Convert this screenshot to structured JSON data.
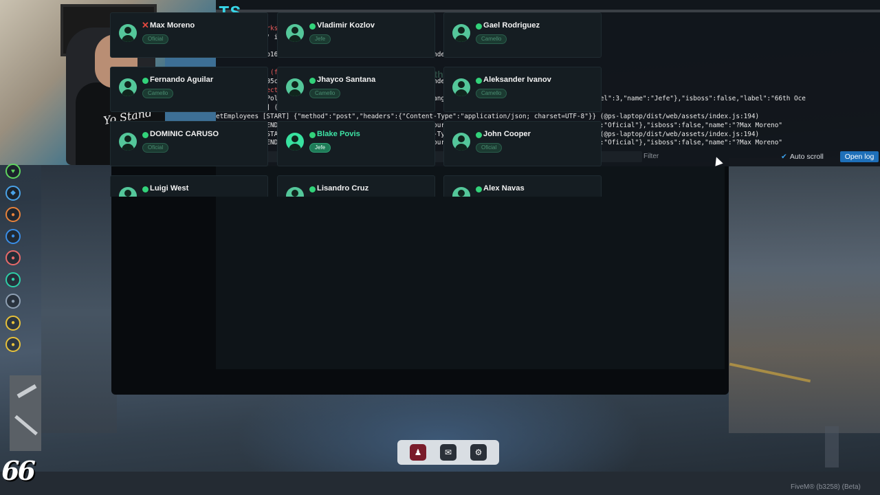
{
  "console": {
    "logo": "TS",
    "ghost_title": "66th Ocean Drive",
    "lines": [
      {
        "pre": "",
        "text": "             rks/qb.lua:25:",
        "cls": "red"
      },
      {
        "pre": "",
        "text": "            y' in resource 'ox_lib':",
        "cls": ""
      },
      {
        "pre": "",
        "text": "",
        "cls": ""
      },
      {
        "pre": "",
        "text": "            9b16e1a58a0f4344d8c10fde7c047803f27 to the index cache.",
        "cls": ""
      },
      {
        "pre": "",
        "text": "",
        "cls": ""
      },
      {
        "pre": "",
        "text": "            e (field 'SoundLoops')",
        "cls": "red"
      },
      {
        "pre": "",
        "text": "            305cf73ab608042e6779605c781ba739cc1 to the index cache.",
        "cls": ""
      },
      {
        "pre": "",
        "text": "            ject by ID 3078",
        "cls": "red"
      },
      {
        "pre": "",
        "text": "            sPolice\":false,\"playerData\":{\"optin\":true,\"gang\":{\"name\":\"66thoceandrive\",\"grade\":{\"level\":3,\"name\":\"Jefe\"},\"isboss\":false,\"label\":\"66th Oce",
        "cls": ""
      },
      {
        "pre": "",
        "text": "            t] (@ps-laptop/dist/web/assets/index.js:198)",
        "cls": ""
      },
      {
        "pre": "",
        "text": "etEmployees [START] {\"method\":\"post\",\"headers\":{\"Content-Type\":\"application/json; charset=UTF-8\"}} (@ps-laptop/dist/web/assets/index.js:194)",
        "cls": ""
      },
      {
        "pre": "",
        "text": "etEmployees [END] {\"date\":\"13/03/26\",\"employees\":[{\"empSource\":\"BLC45751\",\"grade\":{\"level\":1,\"name\":\"Oficial\"},\"isboss\":false,\"name\":\"?Max Moreno\"",
        "cls": ""
      },
      {
        "pre": "",
        "text": "etEmployees [START] {\"method\":\"post\",\"headers\":{\"Content-Type\":\"application/json; charset=UTF-8\"}} (@ps-laptop/dist/web/assets/index.js:194)",
        "cls": ""
      },
      {
        "pre": "",
        "text": "etEmployees [END] {\"date\":\"13/03/26\",\"employees\":[{\"empSource\":\"BLC45751\",\"grade\":{\"level\":1,\"name\":\"Oficial\"},\"isboss\":false,\"name\":\"?Max Moreno\"",
        "cls": ""
      }
    ],
    "filter_placeholder": "Filter",
    "auto_scroll_label": "Auto scroll",
    "open_log_label": "Open log"
  },
  "members": [
    {
      "name": "Max Moreno",
      "rank": "Oficial",
      "status": "offline",
      "highlight": false
    },
    {
      "name": "Vladimir Kozlov",
      "rank": "Jefe",
      "status": "online",
      "highlight": false
    },
    {
      "name": "Gael Rodriguez",
      "rank": "Camello",
      "status": "online",
      "highlight": false
    },
    {
      "name": "Fernando Aguilar",
      "rank": "Camello",
      "status": "online",
      "highlight": false
    },
    {
      "name": "Jhayco Santana",
      "rank": "Camello",
      "status": "online",
      "highlight": false
    },
    {
      "name": "Aleksander Ivanov",
      "rank": "Camello",
      "status": "online",
      "highlight": false
    },
    {
      "name": "DOMINIC CARUSO",
      "rank": "Oficial",
      "status": "online",
      "highlight": false
    },
    {
      "name": "Blake Povis",
      "rank": "Jefe",
      "status": "online",
      "highlight": true
    },
    {
      "name": "John Cooper",
      "rank": "Oficial",
      "status": "online",
      "highlight": false
    },
    {
      "name": "Luigi West",
      "rank": "",
      "status": "online",
      "highlight": false
    },
    {
      "name": "Lisandro Cruz",
      "rank": "",
      "status": "online",
      "highlight": false
    },
    {
      "name": "Alex Navas",
      "rank": "",
      "status": "online",
      "highlight": false
    }
  ],
  "webcam": {
    "shirt_text": "Yo Stand"
  },
  "hud": {
    "icons": [
      {
        "name": "health-icon",
        "color": "#5fd45f",
        "glyph": "♥"
      },
      {
        "name": "armor-icon",
        "color": "#4aa3e8",
        "glyph": "◆"
      },
      {
        "name": "hunger-icon",
        "color": "#e8823a",
        "glyph": "●"
      },
      {
        "name": "thirst-icon",
        "color": "#3a8ee8",
        "glyph": "●"
      },
      {
        "name": "stress-icon",
        "color": "#e86a6a",
        "glyph": "●"
      },
      {
        "name": "eye-icon",
        "color": "#2ecfa8",
        "glyph": "●"
      },
      {
        "name": "headset-icon",
        "color": "#8fa0b3",
        "glyph": "●"
      },
      {
        "name": "stamina-icon",
        "color": "#e8c23a",
        "glyph": "●"
      },
      {
        "name": "money-icon",
        "color": "#e8c23a",
        "glyph": "●"
      }
    ],
    "logo": "66"
  },
  "dock": {
    "items": [
      {
        "name": "notification-icon",
        "glyph": "♟",
        "active": true
      },
      {
        "name": "mail-icon",
        "glyph": "✉",
        "active": false
      },
      {
        "name": "settings-icon",
        "glyph": "⚙",
        "active": false
      }
    ]
  },
  "footer": {
    "build": "FiveM® (b3258) (Beta)"
  }
}
